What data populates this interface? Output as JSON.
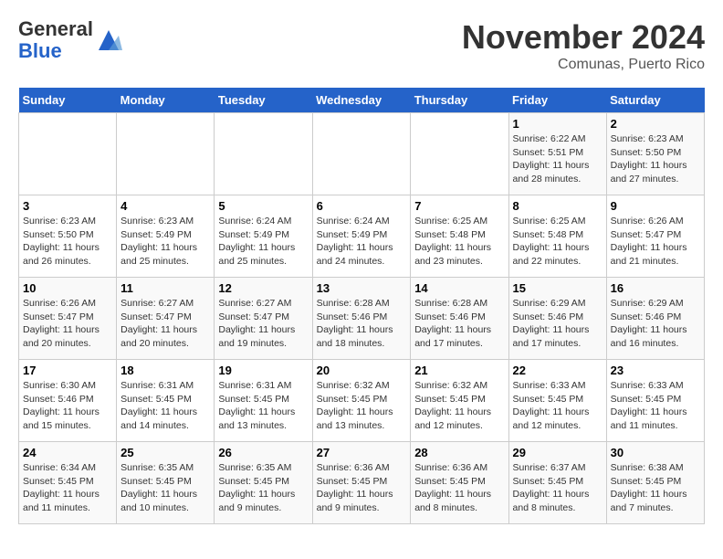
{
  "header": {
    "logo_general": "General",
    "logo_blue": "Blue",
    "title": "November 2024",
    "location": "Comunas, Puerto Rico"
  },
  "weekdays": [
    "Sunday",
    "Monday",
    "Tuesday",
    "Wednesday",
    "Thursday",
    "Friday",
    "Saturday"
  ],
  "weeks": [
    [
      {
        "day": "",
        "info": ""
      },
      {
        "day": "",
        "info": ""
      },
      {
        "day": "",
        "info": ""
      },
      {
        "day": "",
        "info": ""
      },
      {
        "day": "",
        "info": ""
      },
      {
        "day": "1",
        "info": "Sunrise: 6:22 AM\nSunset: 5:51 PM\nDaylight: 11 hours and 28 minutes."
      },
      {
        "day": "2",
        "info": "Sunrise: 6:23 AM\nSunset: 5:50 PM\nDaylight: 11 hours and 27 minutes."
      }
    ],
    [
      {
        "day": "3",
        "info": "Sunrise: 6:23 AM\nSunset: 5:50 PM\nDaylight: 11 hours and 26 minutes."
      },
      {
        "day": "4",
        "info": "Sunrise: 6:23 AM\nSunset: 5:49 PM\nDaylight: 11 hours and 25 minutes."
      },
      {
        "day": "5",
        "info": "Sunrise: 6:24 AM\nSunset: 5:49 PM\nDaylight: 11 hours and 25 minutes."
      },
      {
        "day": "6",
        "info": "Sunrise: 6:24 AM\nSunset: 5:49 PM\nDaylight: 11 hours and 24 minutes."
      },
      {
        "day": "7",
        "info": "Sunrise: 6:25 AM\nSunset: 5:48 PM\nDaylight: 11 hours and 23 minutes."
      },
      {
        "day": "8",
        "info": "Sunrise: 6:25 AM\nSunset: 5:48 PM\nDaylight: 11 hours and 22 minutes."
      },
      {
        "day": "9",
        "info": "Sunrise: 6:26 AM\nSunset: 5:47 PM\nDaylight: 11 hours and 21 minutes."
      }
    ],
    [
      {
        "day": "10",
        "info": "Sunrise: 6:26 AM\nSunset: 5:47 PM\nDaylight: 11 hours and 20 minutes."
      },
      {
        "day": "11",
        "info": "Sunrise: 6:27 AM\nSunset: 5:47 PM\nDaylight: 11 hours and 20 minutes."
      },
      {
        "day": "12",
        "info": "Sunrise: 6:27 AM\nSunset: 5:47 PM\nDaylight: 11 hours and 19 minutes."
      },
      {
        "day": "13",
        "info": "Sunrise: 6:28 AM\nSunset: 5:46 PM\nDaylight: 11 hours and 18 minutes."
      },
      {
        "day": "14",
        "info": "Sunrise: 6:28 AM\nSunset: 5:46 PM\nDaylight: 11 hours and 17 minutes."
      },
      {
        "day": "15",
        "info": "Sunrise: 6:29 AM\nSunset: 5:46 PM\nDaylight: 11 hours and 17 minutes."
      },
      {
        "day": "16",
        "info": "Sunrise: 6:29 AM\nSunset: 5:46 PM\nDaylight: 11 hours and 16 minutes."
      }
    ],
    [
      {
        "day": "17",
        "info": "Sunrise: 6:30 AM\nSunset: 5:46 PM\nDaylight: 11 hours and 15 minutes."
      },
      {
        "day": "18",
        "info": "Sunrise: 6:31 AM\nSunset: 5:45 PM\nDaylight: 11 hours and 14 minutes."
      },
      {
        "day": "19",
        "info": "Sunrise: 6:31 AM\nSunset: 5:45 PM\nDaylight: 11 hours and 13 minutes."
      },
      {
        "day": "20",
        "info": "Sunrise: 6:32 AM\nSunset: 5:45 PM\nDaylight: 11 hours and 13 minutes."
      },
      {
        "day": "21",
        "info": "Sunrise: 6:32 AM\nSunset: 5:45 PM\nDaylight: 11 hours and 12 minutes."
      },
      {
        "day": "22",
        "info": "Sunrise: 6:33 AM\nSunset: 5:45 PM\nDaylight: 11 hours and 12 minutes."
      },
      {
        "day": "23",
        "info": "Sunrise: 6:33 AM\nSunset: 5:45 PM\nDaylight: 11 hours and 11 minutes."
      }
    ],
    [
      {
        "day": "24",
        "info": "Sunrise: 6:34 AM\nSunset: 5:45 PM\nDaylight: 11 hours and 11 minutes."
      },
      {
        "day": "25",
        "info": "Sunrise: 6:35 AM\nSunset: 5:45 PM\nDaylight: 11 hours and 10 minutes."
      },
      {
        "day": "26",
        "info": "Sunrise: 6:35 AM\nSunset: 5:45 PM\nDaylight: 11 hours and 9 minutes."
      },
      {
        "day": "27",
        "info": "Sunrise: 6:36 AM\nSunset: 5:45 PM\nDaylight: 11 hours and 9 minutes."
      },
      {
        "day": "28",
        "info": "Sunrise: 6:36 AM\nSunset: 5:45 PM\nDaylight: 11 hours and 8 minutes."
      },
      {
        "day": "29",
        "info": "Sunrise: 6:37 AM\nSunset: 5:45 PM\nDaylight: 11 hours and 8 minutes."
      },
      {
        "day": "30",
        "info": "Sunrise: 6:38 AM\nSunset: 5:45 PM\nDaylight: 11 hours and 7 minutes."
      }
    ]
  ]
}
